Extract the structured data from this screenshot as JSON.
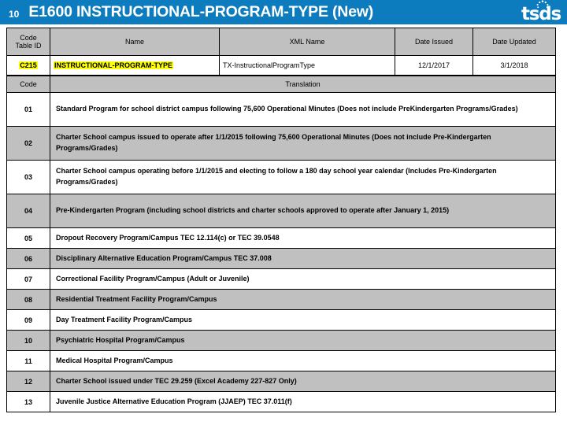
{
  "banner": {
    "slide_number": "10",
    "title": "E1600  INSTRUCTIONAL-PROGRAM-TYPE (New)",
    "logo_text": "tsds",
    "background_color": "#0d7cbe",
    "text_color": "#ffffff"
  },
  "meta_table": {
    "headers": {
      "code_table_id_line1": "Code",
      "code_table_id_line2": "Table ID",
      "name": "Name",
      "xml_name": "XML Name",
      "date_issued": "Date Issued",
      "date_updated": "Date Updated"
    },
    "row": {
      "code_table_id": "C215",
      "name": "INSTRUCTIONAL-PROGRAM-TYPE",
      "xml_name": "TX-InstructionalProgramType",
      "date_issued": "12/1/2017",
      "date_updated": "3/1/2018"
    },
    "highlight_color": "#ffff00",
    "header_background": "#c0c0c0"
  },
  "codes_table": {
    "headers": {
      "code": "Code",
      "translation": "Translation"
    },
    "rows": [
      {
        "code": "01",
        "translation": "Standard Program for school district campus following 75,600 Operational Minutes (Does not include PreKindergarten Programs/Grades)"
      },
      {
        "code": "02",
        "translation": "Charter School campus issued to operate after 1/1/2015  following 75,600 Operational Minutes (Does not include Pre-Kindergarten Programs/Grades)"
      },
      {
        "code": "03",
        "translation": "Charter School campus operating before 1/1/2015 and electing to follow a 180 day school year calendar (Includes Pre-Kindergarten Programs/Grades)"
      },
      {
        "code": "04",
        "translation": "Pre-Kindergarten Program (including school districts and charter schools approved to operate after January 1, 2015)"
      },
      {
        "code": "05",
        "translation": "Dropout Recovery Program/Campus TEC 12.114(c) or TEC 39.0548"
      },
      {
        "code": "06",
        "translation": "Disciplinary Alternative Education Program/Campus TEC 37.008"
      },
      {
        "code": "07",
        "translation": "Correctional Facility Program/Campus (Adult or Juvenile)"
      },
      {
        "code": "08",
        "translation": "Residential Treatment Facility Program/Campus"
      },
      {
        "code": "09",
        "translation": "Day Treatment Facility Program/Campus"
      },
      {
        "code": "10",
        "translation": "Psychiatric Hospital Program/Campus"
      },
      {
        "code": "11",
        "translation": "Medical Hospital Program/Campus"
      },
      {
        "code": "12",
        "translation": "Charter School issued under TEC 29.259 (Excel Academy 227-827 Only)"
      },
      {
        "code": "13",
        "translation": "Juvenile Justice Alternative Education Program (JJAEP) TEC 37.011(f)"
      }
    ],
    "row_shading": [
      "white",
      "gray",
      "white",
      "gray",
      "white",
      "gray",
      "white",
      "gray",
      "white",
      "gray",
      "white",
      "gray",
      "white"
    ],
    "row_heights": [
      "tall",
      "tall",
      "tall",
      "tall",
      "short",
      "short",
      "short",
      "short",
      "short",
      "short",
      "short",
      "short",
      "short"
    ]
  }
}
